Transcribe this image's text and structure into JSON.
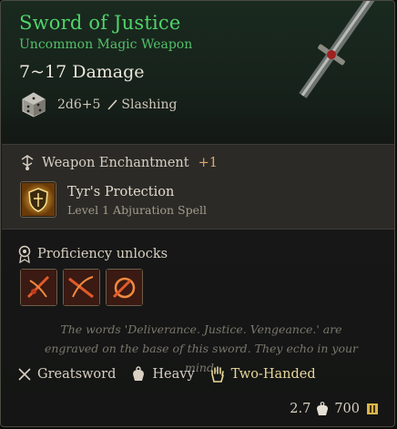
{
  "item": {
    "name": "Sword of Justice",
    "rarity_type": "Uncommon Magic Weapon",
    "damage": "7~17 Damage",
    "dice": "2d6+5",
    "damage_type": "Slashing",
    "name_color": "#4fd46a"
  },
  "enchantment": {
    "label": "Weapon Enchantment",
    "bonus": "+1",
    "spell_name": "Tyr's Protection",
    "spell_detail": "Level 1 Abjuration Spell"
  },
  "proficiency": {
    "label": "Proficiency unlocks",
    "icons": [
      "flourish-icon",
      "lacerate-icon",
      "pommel-strike-icon"
    ]
  },
  "flavor": "The words 'Deliverance. Justice. Vengeance.' are engraved on the base of this sword. They echo in your mind.",
  "properties": {
    "type": "Greatsword",
    "weight_class": "Heavy",
    "handedness": "Two-Handed"
  },
  "footer": {
    "weight": "2.7",
    "value": "700"
  }
}
